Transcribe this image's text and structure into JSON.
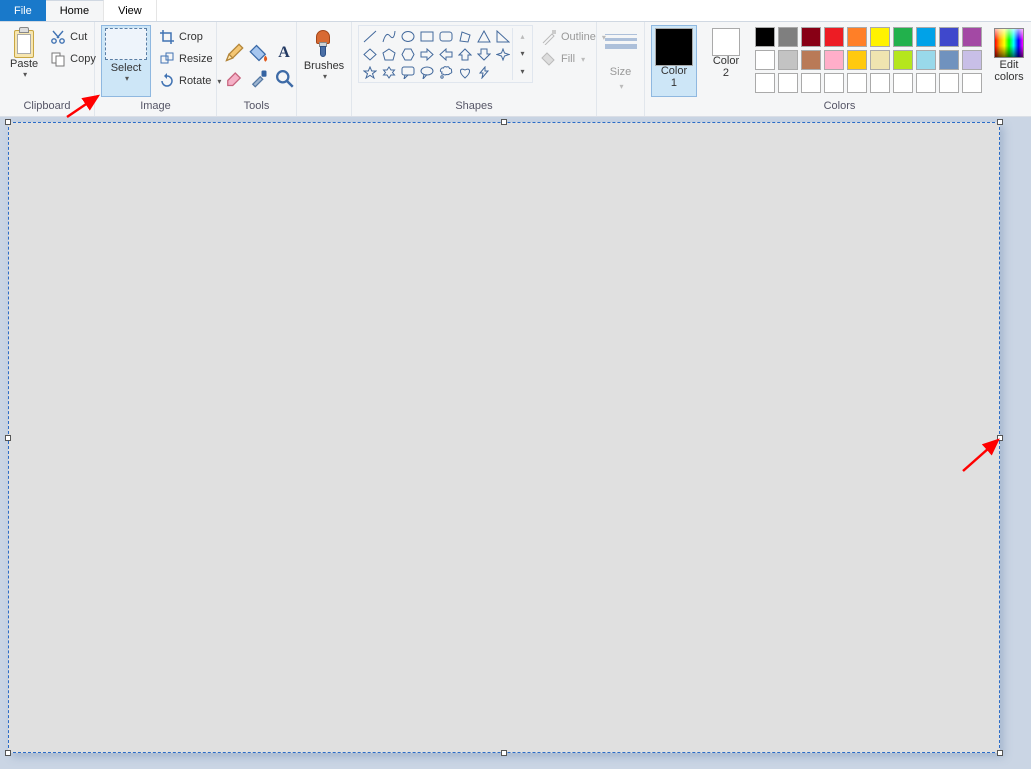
{
  "tabs": {
    "file": "File",
    "home": "Home",
    "view": "View"
  },
  "clipboard": {
    "paste": "Paste",
    "cut": "Cut",
    "copy": "Copy",
    "label": "Clipboard"
  },
  "image": {
    "select": "Select",
    "crop": "Crop",
    "resize": "Resize",
    "rotate": "Rotate",
    "label": "Image"
  },
  "tools": {
    "label": "Tools"
  },
  "brushes": {
    "label": "Brushes"
  },
  "shapes": {
    "outline": "Outline",
    "fill": "Fill",
    "label": "Shapes"
  },
  "size": {
    "label": "Size"
  },
  "colors": {
    "color1": "Color\n1",
    "color2": "Color\n2",
    "edit": "Edit\ncolors",
    "label": "Colors",
    "color1_value": "#000000",
    "color2_value": "#ffffff",
    "palette_row1": [
      "#000000",
      "#7f7f7f",
      "#880015",
      "#ed1c24",
      "#ff7f27",
      "#fff200",
      "#22b14c",
      "#00a2e8",
      "#3f48cc",
      "#a349a4"
    ],
    "palette_row2": [
      "#ffffff",
      "#c3c3c3",
      "#b97a57",
      "#ffaec9",
      "#ffc90e",
      "#efe4b0",
      "#b5e61d",
      "#99d9ea",
      "#7092be",
      "#c8bfe7"
    ],
    "palette_row3": [
      "#ffffff",
      "#ffffff",
      "#ffffff",
      "#ffffff",
      "#ffffff",
      "#ffffff",
      "#ffffff",
      "#ffffff",
      "#ffffff",
      "#ffffff"
    ]
  }
}
